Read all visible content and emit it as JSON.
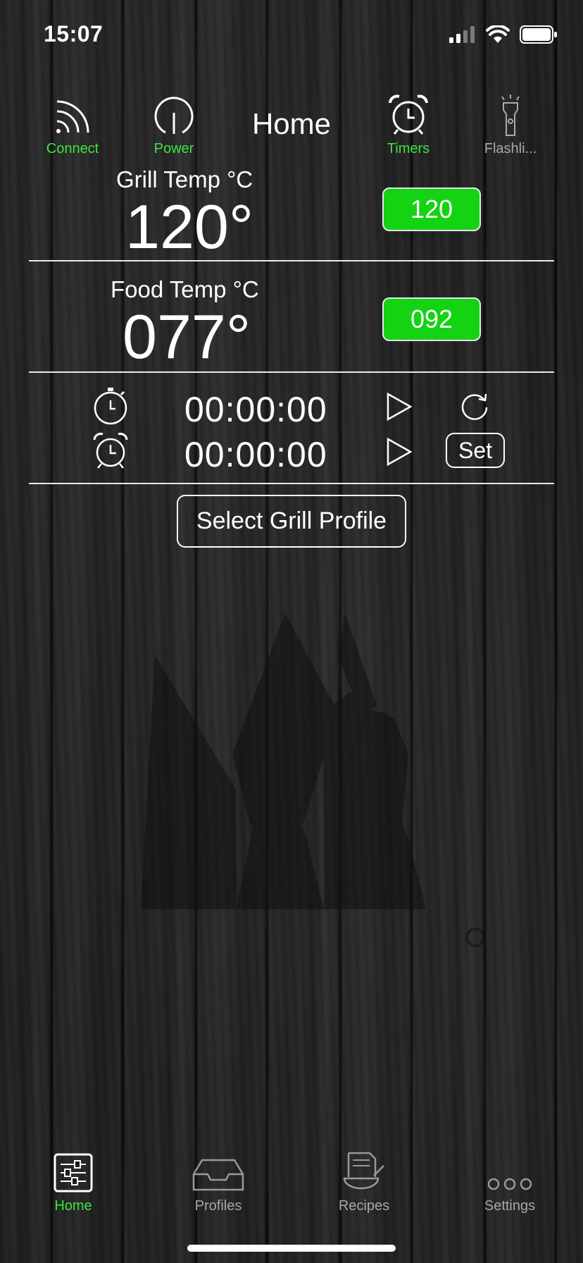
{
  "status_bar": {
    "time": "15:07"
  },
  "top_nav": {
    "title": "Home",
    "items": [
      {
        "label": "Connect",
        "icon": "wifi-signal-icon"
      },
      {
        "label": "Power",
        "icon": "power-icon"
      },
      {
        "label": "Timers",
        "icon": "alarm-clock-icon"
      },
      {
        "label": "Flashli...",
        "icon": "flashlight-icon"
      }
    ]
  },
  "grill": {
    "label": "Grill Temp °C",
    "value": "120°",
    "setpoint": "120"
  },
  "food": {
    "label": "Food Temp °C",
    "value": "077°",
    "setpoint": "092"
  },
  "timers": {
    "stopwatch": {
      "value": "00:00:00",
      "icon": "stopwatch-icon"
    },
    "alarm": {
      "value": "00:00:00",
      "icon": "alarm-clock-icon",
      "set_label": "Set"
    }
  },
  "profile_button": "Select Grill Profile",
  "tab_bar": {
    "items": [
      {
        "label": "Home",
        "icon": "sliders-icon",
        "active": true
      },
      {
        "label": "Profiles",
        "icon": "tray-icon",
        "active": false
      },
      {
        "label": "Recipes",
        "icon": "recipe-book-icon",
        "active": false
      },
      {
        "label": "Settings",
        "icon": "more-dots-icon",
        "active": false
      }
    ]
  },
  "colors": {
    "accent_green": "#3ee33e",
    "setpoint_green": "#13d313",
    "background": "#2a2a2a"
  }
}
